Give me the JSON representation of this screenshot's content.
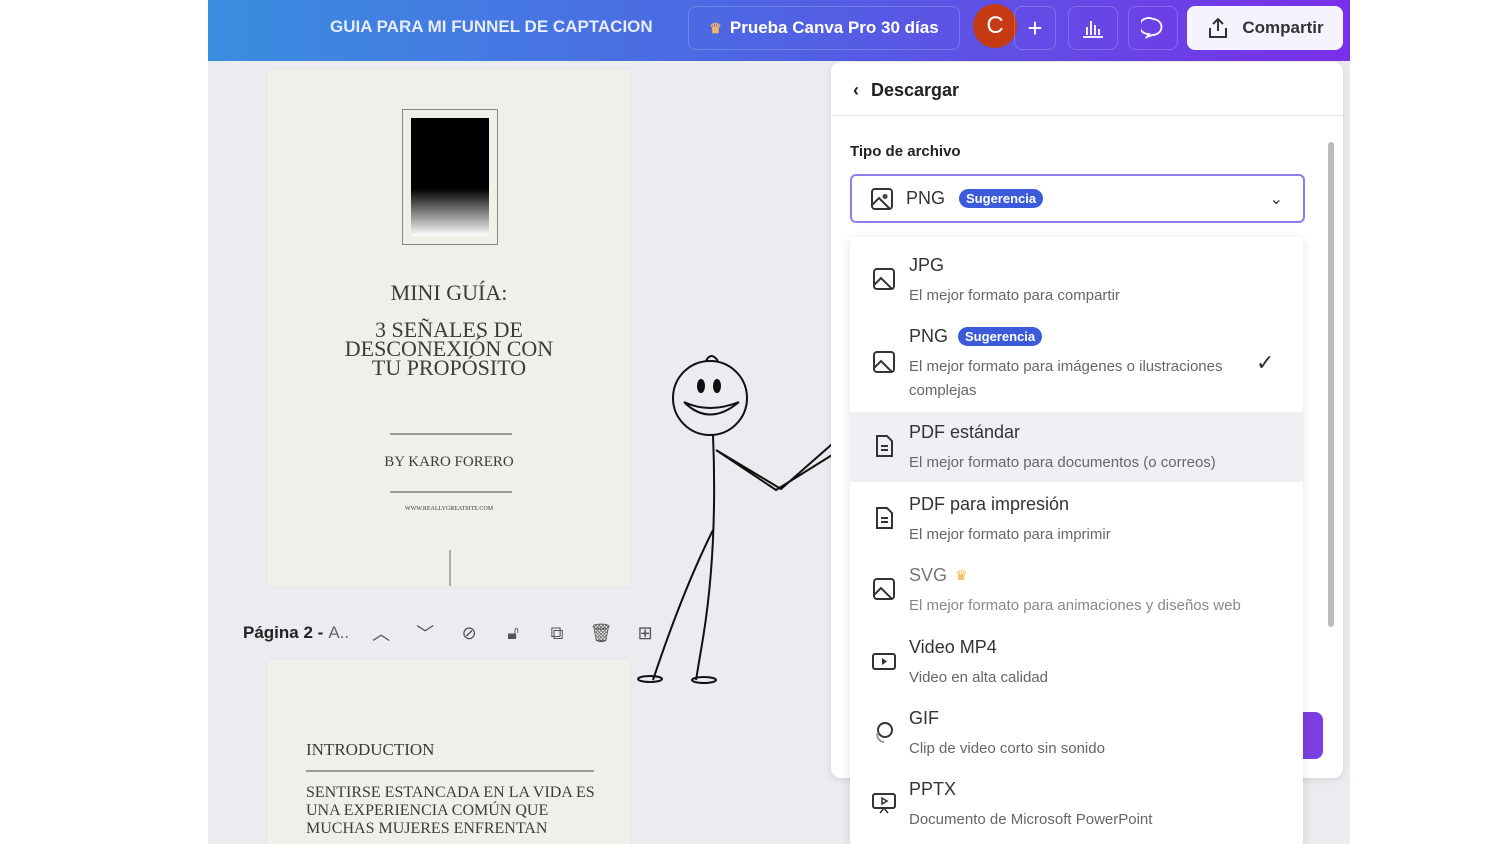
{
  "topbar": {
    "title": "GUIA PARA MI FUNNEL DE CAPTACION",
    "trial": "Prueba Canva Pro 30 días",
    "avatar": "C",
    "share": "Compartir"
  },
  "page1": {
    "title": "MINI GUÍA:",
    "subtitle": "3 SEÑALES DE DESCONEXIÓN CON TU PROPÓSITO",
    "author": "BY KARO FORERO",
    "site": "WWW.REALLYGREATSITE.COM"
  },
  "page_bar": {
    "label": "Página 2 -",
    "name": "A.."
  },
  "page2": {
    "heading": "INTRODUCTION",
    "body": "SENTIRSE ESTANCADA EN LA VIDA ES UNA EXPERIENCIA COMÚN QUE MUCHAS MUJERES ENFRENTAN"
  },
  "panel": {
    "back": "Descargar",
    "file_type_label": "Tipo de archivo",
    "selected": "PNG",
    "selected_badge": "Sugerencia"
  },
  "options": [
    {
      "name": "JPG",
      "desc": "El mejor formato para compartir",
      "icon": "image-icon"
    },
    {
      "name": "PNG",
      "badge": "Sugerencia",
      "desc": "El mejor formato para imágenes o ilustraciones complejas",
      "icon": "image-icon",
      "checked": true
    },
    {
      "name": "PDF estándar",
      "desc": "El mejor formato para documentos (o correos)",
      "icon": "document-icon"
    },
    {
      "name": "PDF para impresión",
      "desc": "El mejor formato para imprimir",
      "icon": "document-icon"
    },
    {
      "name": "SVG",
      "desc": "El mejor formato para animaciones y diseños web",
      "icon": "image-icon",
      "pro": true
    },
    {
      "name": "Video MP4",
      "desc": "Video en alta calidad",
      "icon": "video-icon"
    },
    {
      "name": "GIF",
      "desc": "Clip de video corto sin sonido",
      "icon": "gif-icon"
    },
    {
      "name": "PPTX",
      "desc": "Documento de Microsoft PowerPoint",
      "icon": "presentation-icon"
    }
  ]
}
